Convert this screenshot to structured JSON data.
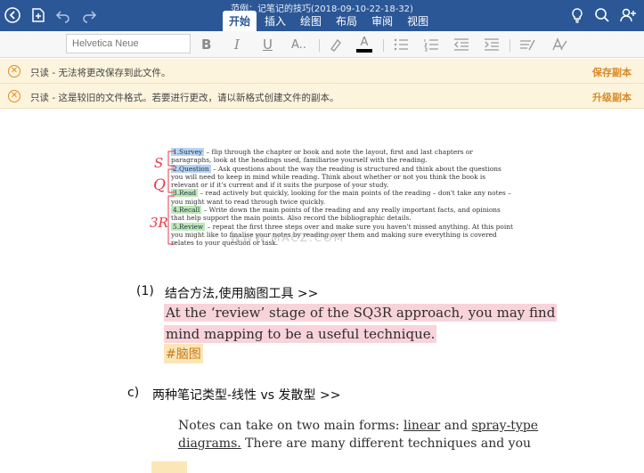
{
  "window": {
    "title": "范例：记笔记的技巧(2018-09-10-22-18-32)"
  },
  "tabs": [
    {
      "label": "开始",
      "active": true
    },
    {
      "label": "插入",
      "active": false
    },
    {
      "label": "绘图",
      "active": false
    },
    {
      "label": "布局",
      "active": false
    },
    {
      "label": "审阅",
      "active": false
    },
    {
      "label": "视图",
      "active": false
    }
  ],
  "toolbar": {
    "font_placeholder": "Helvetica Neue",
    "bold": "B",
    "italic": "I",
    "underline": "U",
    "font_size": "A..",
    "font_color": "A"
  },
  "notices": [
    {
      "message": "只读 - 无法将更改保存到此文件。",
      "action": "保存副本"
    },
    {
      "message": "只读 - 这是较旧的文件格式。若要进行更改，请以新格式创建文件的副本。",
      "action": "升级副本"
    }
  ],
  "scan": {
    "marks": {
      "s": "S",
      "q": "Q",
      "r": "3R"
    },
    "survey_label": "1.Survey",
    "survey_text": "– flip through the chapter or book and note the layout, first and last chapters or paragraphs, look at the headings used, familiarise yourself with the reading.",
    "question_label": "2.Question",
    "question_text": "– Ask questions about the way the reading is structured and think about the questions you will need to keep in mind while reading. Think about whether or not you think the book is relevant or if it's current and if it suits the purpose of your study.",
    "read_label": "3.Read",
    "read_text": "– read actively but quickly, looking for the main points of the reading – don't take any notes – you might want to read through twice quickly.",
    "recall_label": "4.Recall",
    "recall_text": "– Write down the main points of the reading and any really important facts, and opinions that help support the main points. Also record the bibliographic details.",
    "review_label": "5.Review",
    "review_text": "– repeat the first three steps over and make sure you haven't missed anything. At this point you might like to finalise your notes by reading over them and making sure everything is covered relates to your question or task.",
    "watermark": "WWW.MACZ.COM"
  },
  "section1": {
    "number": "(1)",
    "title": "结合方法,使用脑图工具 >>",
    "line1": "At the ‘review’ stage of the SQ3R approach, you may find",
    "line2": "mind mapping to be a useful technique.",
    "tag": "#脑图"
  },
  "section_c": {
    "number": "c)",
    "title": "两种笔记类型-线性 vs 发散型 >>",
    "notes_line1_pre": "Notes can take on two main forms: ",
    "notes_line1_u1": "linear",
    "notes_line1_mid": " and ",
    "notes_line1_u2": "spray-type",
    "notes_line2_u": "diagrams.",
    "notes_line2_post": " There are many different techniques and you"
  }
}
